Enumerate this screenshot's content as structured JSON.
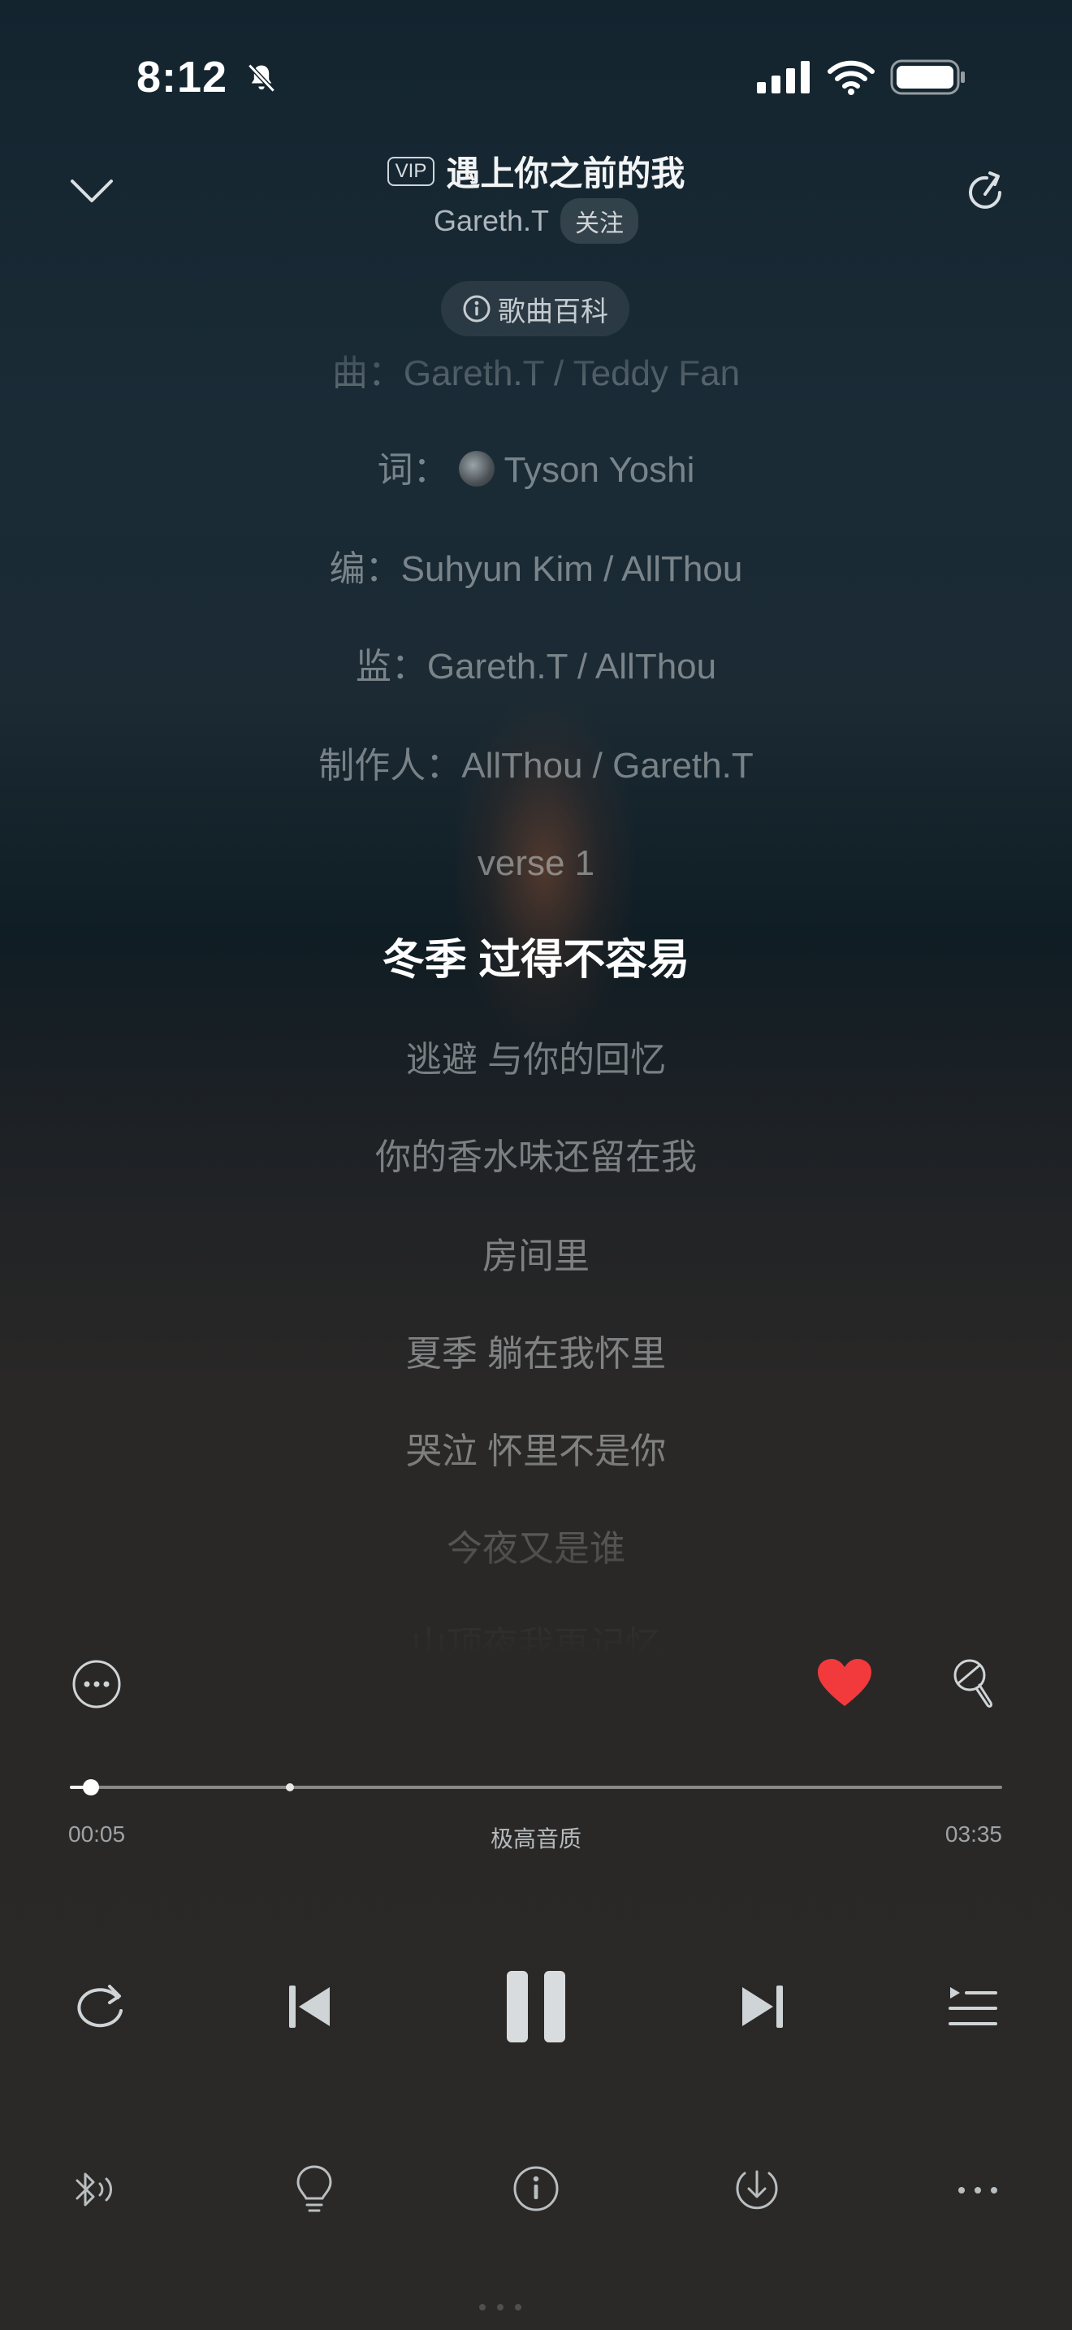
{
  "status_bar": {
    "time": "8:12"
  },
  "header": {
    "vip_label": "VIP",
    "title": "遇上你之前的我",
    "artist": "Gareth.T",
    "follow_label": "关注",
    "wiki_label": "歌曲百科"
  },
  "lyrics": {
    "lines": [
      "曲：Gareth.T / Teddy Fan",
      "Tyson Yoshi",
      "编：Suhyun Kim / AllThou",
      "监：Gareth.T / AllThou",
      "制作人：AllThou / Gareth.T",
      "verse 1",
      "冬季 过得不容易",
      "逃避 与你的回忆",
      "你的香水味还留在我",
      "房间里",
      "夏季 躺在我怀里",
      "哭泣 怀里不是你",
      "今夜又是谁",
      "山顶夜我再记忆"
    ],
    "lyricist_prefix": "词：",
    "active_index": 6
  },
  "player": {
    "elapsed": "00:05",
    "duration": "03:35",
    "quality": "极高音质",
    "progress": 0.023,
    "liked": true,
    "colors": {
      "like": "#f23a3c",
      "accent": "#ffffff"
    }
  },
  "icons": {
    "top_left": "chevron-down-icon",
    "top_right": "share-icon",
    "comment": "comment-icon",
    "like": "heart-icon",
    "sing": "microphone-icon",
    "repeat": "repeat-icon",
    "prev": "skip-previous-icon",
    "pause": "pause-icon",
    "next": "skip-next-icon",
    "playlist": "playlist-icon",
    "bluetooth": "bluetooth-audio-icon",
    "light": "lightbulb-icon",
    "info": "info-icon",
    "download": "download-icon",
    "more": "more-icon"
  }
}
